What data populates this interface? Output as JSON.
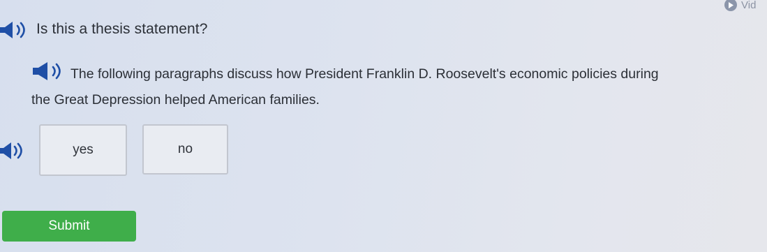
{
  "video_badge": {
    "label": "Vid",
    "icon": "play-icon"
  },
  "question": {
    "text": "Is this a thesis statement?",
    "icon": "speaker-icon"
  },
  "passage": {
    "line1": "The following paragraphs discuss how President Franklin D. Roosevelt's economic policies during",
    "line2": "the Great Depression helped American families.",
    "icon": "speaker-icon"
  },
  "choices": [
    {
      "label": "yes"
    },
    {
      "label": "no"
    }
  ],
  "choices_icon": "speaker-icon",
  "submit": {
    "label": "Submit"
  },
  "colors": {
    "speaker_blue": "#1f4fa6",
    "submit_green": "#3fae4a",
    "background": "#dde3ef"
  }
}
